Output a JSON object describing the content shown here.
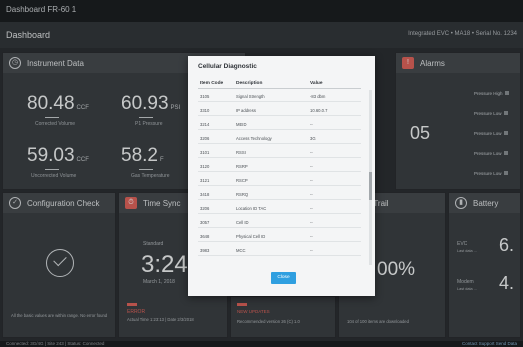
{
  "app": {
    "title": "Dashboard FR-60 1"
  },
  "dashboard": {
    "title": "Dashboard",
    "device_info": "Integrated EVC • MA18 • Serial No. 1234"
  },
  "instrument": {
    "title": "Instrument Data",
    "corrected": {
      "value": "80.48",
      "unit": "CCF",
      "label": "Corrected Volume"
    },
    "pressure": {
      "value": "60.93",
      "unit": "PSI",
      "label": "P1 Pressure"
    },
    "uncorrected": {
      "value": "59.03",
      "unit": "CCF",
      "label": "Uncorrected Volume"
    },
    "temperature": {
      "value": "58.2",
      "unit": "F",
      "label": "Gas Temperature"
    }
  },
  "alarms": {
    "title": "Alarms",
    "count": "05",
    "items": [
      "Pressure High",
      "Pressure Low",
      "Pressure Low",
      "Pressure Low",
      "Pressure Low"
    ]
  },
  "config_check": {
    "title": "Configuration Check",
    "note": "All the basic values are within range. No error found"
  },
  "time_sync": {
    "title": "Time Sync",
    "mode": "Standard",
    "time": "3:24:",
    "date": "March 1, 2018",
    "error_label": "ERROR",
    "error_detail": "Actual Time 1:23:13 | Date 2/3/2018"
  },
  "update": {
    "label": "NEW UPDATES",
    "detail": "Recommended version 26 (C) 1.0"
  },
  "audit": {
    "title": "Audit Trail",
    "percent": "00%",
    "note": "104 of 100 items are downloaded"
  },
  "battery": {
    "title": "Battery",
    "evc_label": "EVC",
    "evc_sub": "Last data ...",
    "evc_value": "6.",
    "modem_label": "Modem",
    "modem_sub": "Last data ...",
    "modem_value": "4."
  },
  "status": {
    "left": "Connected: 3G/4G  |  Site 243  |  Status: Connected",
    "right": "Contact Support   Send Data"
  },
  "modal": {
    "title": "Cellular Diagnostic",
    "headers": {
      "code": "Item Code",
      "desc": "Description",
      "value": "Value"
    },
    "rows": [
      {
        "code": "3105",
        "desc": "Signal Strength",
        "value": "-83 dbm"
      },
      {
        "code": "3310",
        "desc": "IP address",
        "value": "10.60.0.7"
      },
      {
        "code": "3214",
        "desc": "MEID",
        "value": "--"
      },
      {
        "code": "3206",
        "desc": "Access Technology",
        "value": "3G"
      },
      {
        "code": "3101",
        "desc": "RSSI",
        "value": "--"
      },
      {
        "code": "3120",
        "desc": "RSRP",
        "value": "--"
      },
      {
        "code": "3121",
        "desc": "RSCP",
        "value": "--"
      },
      {
        "code": "3418",
        "desc": "RSRQ",
        "value": "--"
      },
      {
        "code": "3206",
        "desc": "Location ID TAC",
        "value": "--"
      },
      {
        "code": "3057",
        "desc": "Cell ID",
        "value": "--"
      },
      {
        "code": "3648",
        "desc": "Physical Cell ID",
        "value": "--"
      },
      {
        "code": "3983",
        "desc": "MCC",
        "value": "--"
      }
    ],
    "close_label": "Close"
  }
}
